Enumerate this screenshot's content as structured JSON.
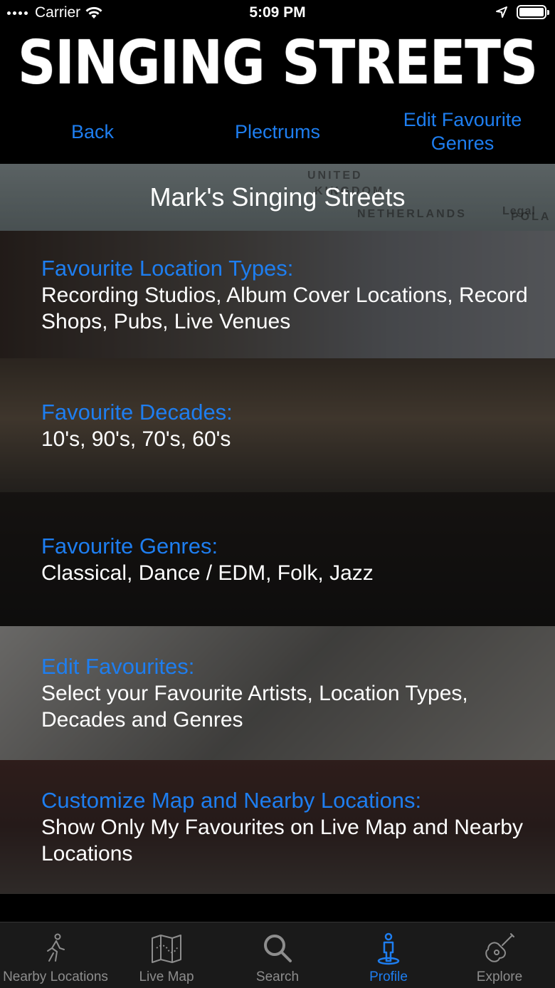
{
  "status_bar": {
    "carrier": "Carrier",
    "time": "5:09 PM"
  },
  "header": {
    "logo_text": "SINGING STREETS"
  },
  "nav": {
    "back": "Back",
    "plectrums": "Plectrums",
    "edit_genres": "Edit Favourite Genres"
  },
  "title_banner": {
    "title": "Mark's Singing Streets",
    "map_labels": [
      "UNITED",
      "KINGDOM",
      "NETHERLANDS",
      "Legal",
      "POLA"
    ]
  },
  "sections": [
    {
      "title": "Favourite Location Types:",
      "body": "Recording Studios, Album Cover Locations, Record Shops, Pubs, Live Venues"
    },
    {
      "title": "Favourite Decades:",
      "body": "10's, 90's, 70's, 60's"
    },
    {
      "title": "Favourite Genres:",
      "body": "Classical, Dance / EDM, Folk, Jazz"
    },
    {
      "title": "Edit Favourites:",
      "body": "Select your Favourite Artists, Location Types, Decades and Genres"
    },
    {
      "title": "Customize Map and Nearby Locations:",
      "body": "Show Only My Favourites on Live Map and Nearby Locations"
    }
  ],
  "tab_bar": {
    "tabs": [
      {
        "label": "Nearby Locations",
        "icon": "walking-person-icon"
      },
      {
        "label": "Live Map",
        "icon": "map-icon"
      },
      {
        "label": "Search",
        "icon": "search-icon"
      },
      {
        "label": "Profile",
        "icon": "profile-icon",
        "active": true
      },
      {
        "label": "Explore",
        "icon": "guitar-icon"
      }
    ]
  },
  "colors": {
    "accent": "#1e7ef0",
    "tab_inactive": "#8d8d8d",
    "background": "#000000"
  }
}
